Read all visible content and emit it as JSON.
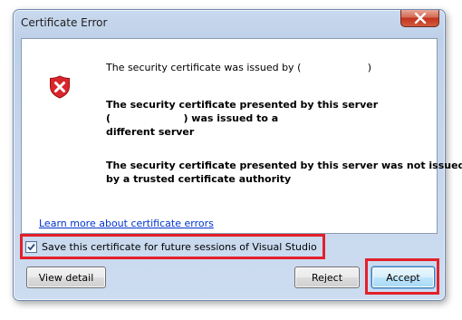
{
  "window": {
    "title": "Certificate Error"
  },
  "message": {
    "issued_by": "The security certificate was issued by (                     )",
    "presented_line1": "The security certificate presented by this server",
    "presented_line2": "(                     ) was issued to a",
    "presented_line3": "different server",
    "untrusted_line1": "The security certificate presented by this server was not issued",
    "untrusted_line2": "by a trusted certificate authority"
  },
  "links": {
    "learn_more": "Learn more about certificate errors"
  },
  "save_option": {
    "label": "Save this certificate for future sessions of Visual Studio",
    "checked": true
  },
  "buttons": {
    "view_detail": "View detail",
    "reject": "Reject",
    "accept": "Accept"
  },
  "icons": {
    "close": "close-icon",
    "error": "error-shield-icon",
    "checkmark": "checkmark-icon"
  },
  "colors": {
    "highlight": "#e3202a",
    "link": "#0033cc",
    "error_icon": "#d8262d"
  }
}
